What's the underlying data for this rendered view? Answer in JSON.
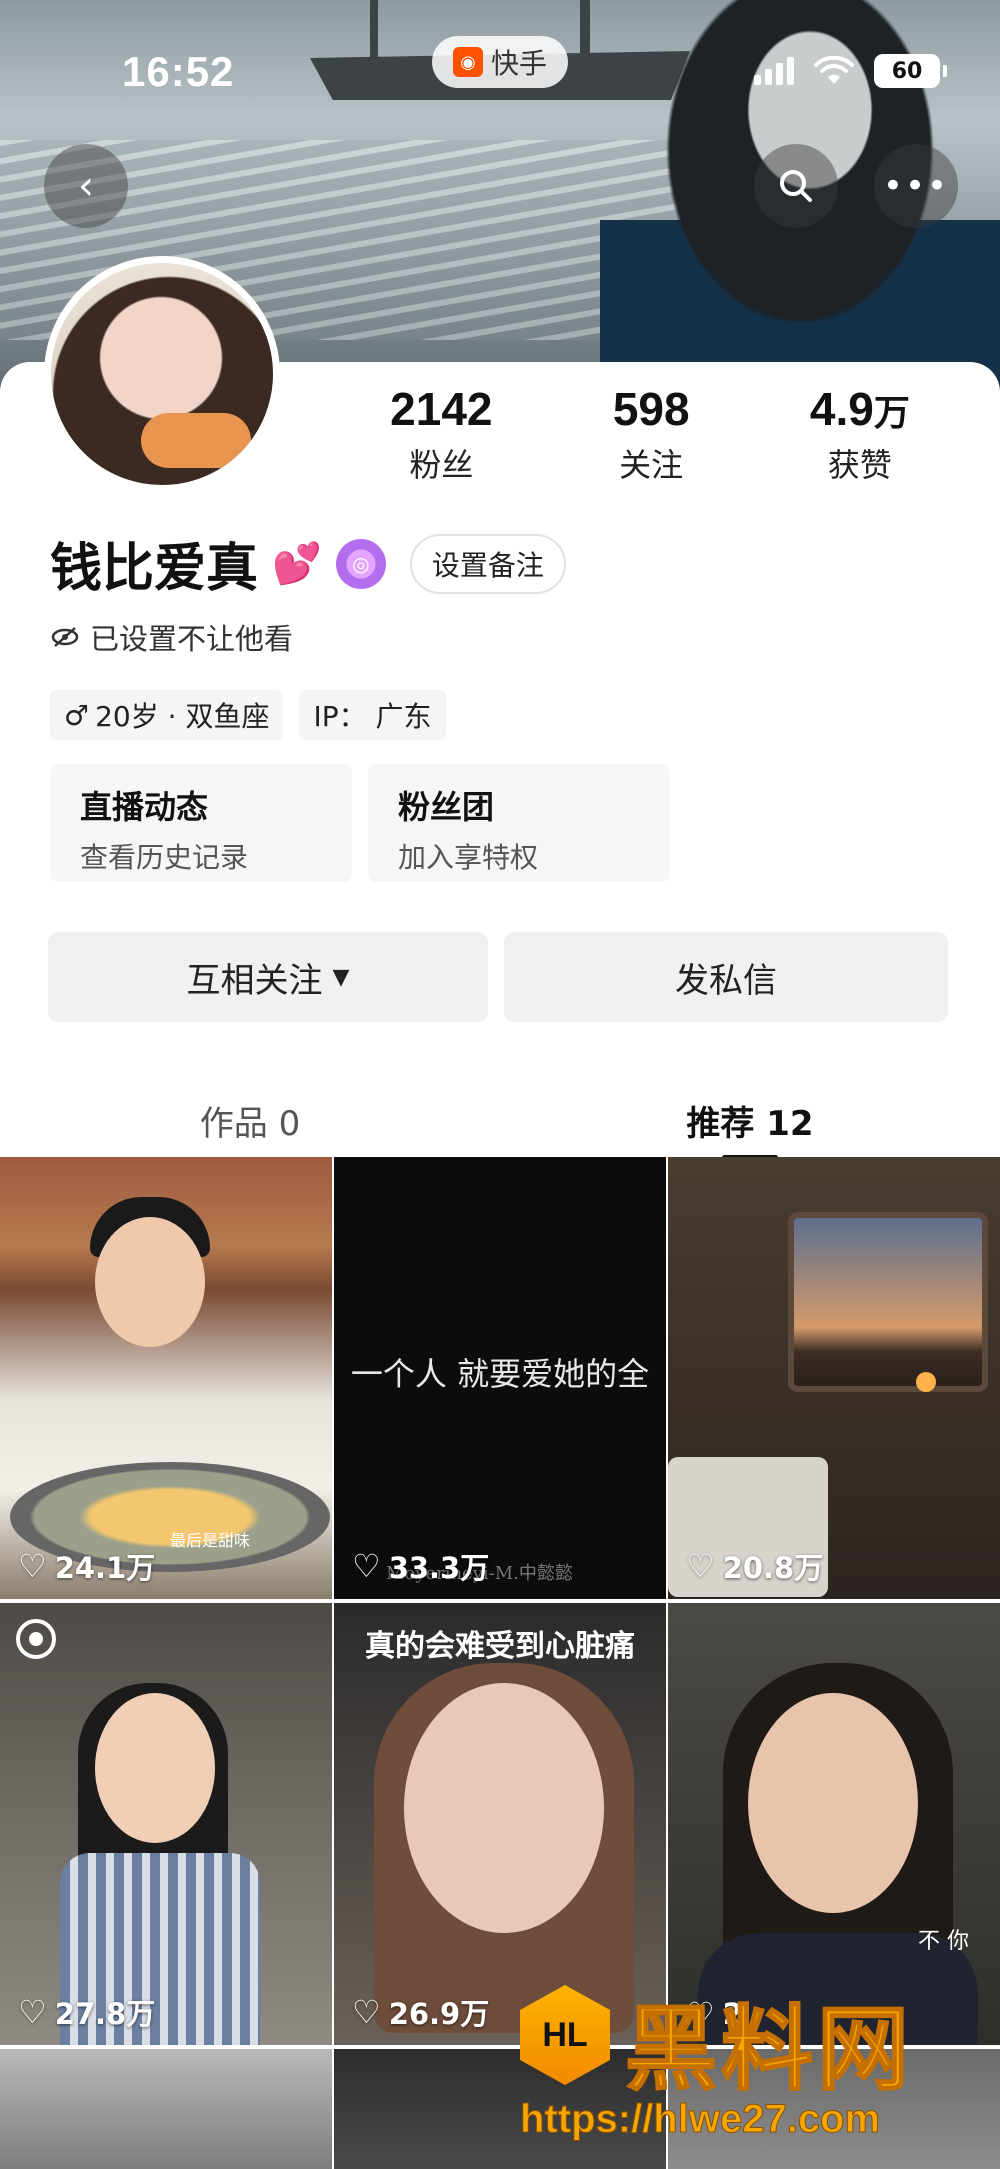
{
  "status_bar": {
    "time": "16:52",
    "app_name": "快手",
    "battery": "60"
  },
  "nav": {
    "back_icon": "chevron-left-icon",
    "search_icon": "search-icon",
    "more_icon": "more-horizontal-icon"
  },
  "profile": {
    "stats": [
      {
        "value": "2142",
        "unit": "",
        "label": "粉丝"
      },
      {
        "value": "598",
        "unit": "",
        "label": "关注"
      },
      {
        "value": "4.9",
        "unit": "万",
        "label": "获赞"
      }
    ],
    "name": "钱比爱真",
    "name_emoji": "💕",
    "remark_button": "设置备注",
    "hidden_status": "已设置不让他看",
    "tags": {
      "gender_age": "20岁 · 双鱼座",
      "gender_symbol": "♂",
      "ip": "IP： 广东"
    },
    "cards": [
      {
        "title": "直播动态",
        "subtitle": "查看历史记录"
      },
      {
        "title": "粉丝团",
        "subtitle": "加入享特权"
      }
    ],
    "actions": {
      "follow": "互相关注",
      "message": "发私信"
    }
  },
  "tabs": [
    {
      "label": "作品 0",
      "active": false
    },
    {
      "label": "推荐 12",
      "active": true
    }
  ],
  "grid": [
    {
      "likes": "24.1万",
      "caption": "最后是甜味"
    },
    {
      "likes": "33.3万",
      "quote": "一个人 就要爱她的全",
      "watermark": "Moyeriheyi-M.中懿懿"
    },
    {
      "likes": "20.8万"
    },
    {
      "likes": "27.8万"
    },
    {
      "likes": "26.9万",
      "overlay_text": "真的会难受到心脏痛"
    },
    {
      "likes": "2",
      "subtitle": "不 你"
    }
  ],
  "watermark": {
    "logo_text": "HL",
    "title": "黑料网",
    "url": "https://hlwe27.com"
  }
}
